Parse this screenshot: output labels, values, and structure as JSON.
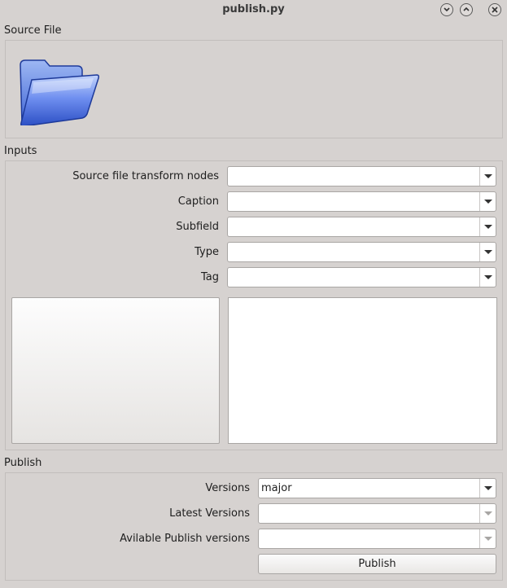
{
  "window": {
    "title": "publish.py"
  },
  "source_file": {
    "label": "Source File",
    "icon": "folder-icon"
  },
  "inputs": {
    "label": "Inputs",
    "fields": [
      {
        "label": "Source file transform nodes",
        "value": ""
      },
      {
        "label": "Caption",
        "value": ""
      },
      {
        "label": "Subfield",
        "value": ""
      },
      {
        "label": "Type",
        "value": ""
      },
      {
        "label": "Tag",
        "value": ""
      }
    ]
  },
  "publish": {
    "label": "Publish",
    "versions": {
      "label": "Versions",
      "value": "major"
    },
    "latest_versions": {
      "label": "Latest Versions",
      "value": ""
    },
    "available_versions": {
      "label": "Avilable Publish versions",
      "value": ""
    },
    "button_label": "Publish"
  },
  "colors": {
    "window_bg": "#d6d2d0",
    "folder_blue": "#3f67d8"
  }
}
